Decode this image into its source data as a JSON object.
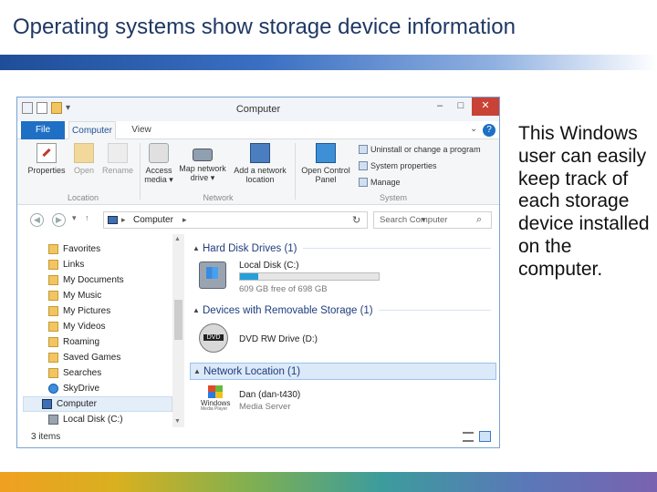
{
  "slide": {
    "title": "Operating systems show storage device information",
    "side_text": "This Windows user can easily keep track of each storage device installed on the computer."
  },
  "window": {
    "title": "Computer",
    "controls": {
      "minimize": "–",
      "maximize": "□",
      "close": "✕"
    }
  },
  "ribbon": {
    "tabs": [
      "File",
      "Computer",
      "View"
    ],
    "buttons": {
      "properties": "Properties",
      "open": "Open",
      "rename": "Rename",
      "access_media": "Access media ▾",
      "map_network_drive": "Map network drive ▾",
      "add_network_location": "Add a network location",
      "open_control_panel": "Open Control Panel"
    },
    "system": {
      "uninstall": "Uninstall or change a program",
      "system_properties": "System properties",
      "manage": "Manage"
    },
    "groups": {
      "location": "Location",
      "network": "Network",
      "system": "System"
    }
  },
  "address": {
    "path": "Computer",
    "search_placeholder": "Search Computer"
  },
  "nav_pane": {
    "items": [
      "Favorites",
      "Links",
      "My Documents",
      "My Music",
      "My Pictures",
      "My Videos",
      "Roaming",
      "Saved Games",
      "Searches",
      "SkyDrive",
      "Computer",
      "Local Disk (C:)"
    ]
  },
  "content": {
    "groups": [
      {
        "header": "Hard Disk Drives (1)"
      },
      {
        "header": "Devices with Removable Storage (1)"
      },
      {
        "header": "Network Location (1)"
      }
    ],
    "local_disk": {
      "name": "Local Disk (C:)",
      "free_text": "609 GB free of 698 GB",
      "used_fraction": 0.13
    },
    "dvd": {
      "name": "DVD RW Drive (D:)",
      "icon_label": "DVD"
    },
    "network": {
      "name": "Dan (dan-t430)",
      "sub": "Media Server",
      "icon_text": "Windows",
      "icon_sub": "Media Player"
    }
  },
  "status": {
    "items": "3 items"
  },
  "colors": {
    "accent": "#1f6fc5",
    "title": "#1f3864",
    "group_header": "#1e3c7e"
  }
}
